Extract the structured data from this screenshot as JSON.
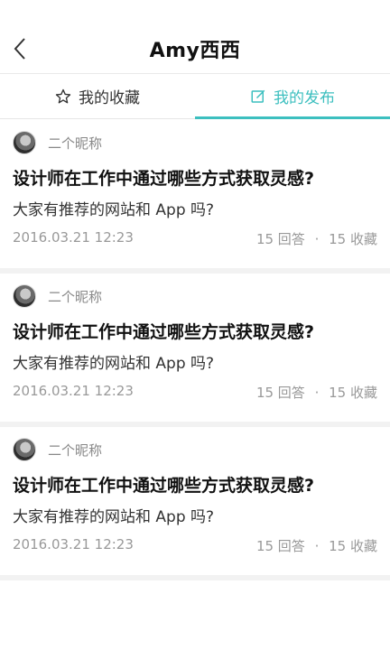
{
  "header": {
    "title": "Amy西西",
    "back_icon": "chevron-left-icon"
  },
  "tabs": [
    {
      "label": "我的收藏",
      "icon": "star-outline-icon",
      "active": false
    },
    {
      "label": "我的发布",
      "icon": "edit-icon",
      "active": true
    }
  ],
  "accent_color": "#3cbfbf",
  "posts": [
    {
      "author": "二个昵称",
      "title": "设计师在工作中通过哪些方式获取灵感?",
      "subtitle": "大家有推荐的网站和 App 吗?",
      "date": "2016.03.21 12:23",
      "answers": "15 回答",
      "separator": "·",
      "favorites": "15 收藏"
    },
    {
      "author": "二个昵称",
      "title": "设计师在工作中通过哪些方式获取灵感?",
      "subtitle": "大家有推荐的网站和 App 吗?",
      "date": "2016.03.21 12:23",
      "answers": "15 回答",
      "separator": "·",
      "favorites": "15 收藏"
    },
    {
      "author": "二个昵称",
      "title": "设计师在工作中通过哪些方式获取灵感?",
      "subtitle": "大家有推荐的网站和 App 吗?",
      "date": "2016.03.21 12:23",
      "answers": "15 回答",
      "separator": "·",
      "favorites": "15 收藏"
    }
  ]
}
